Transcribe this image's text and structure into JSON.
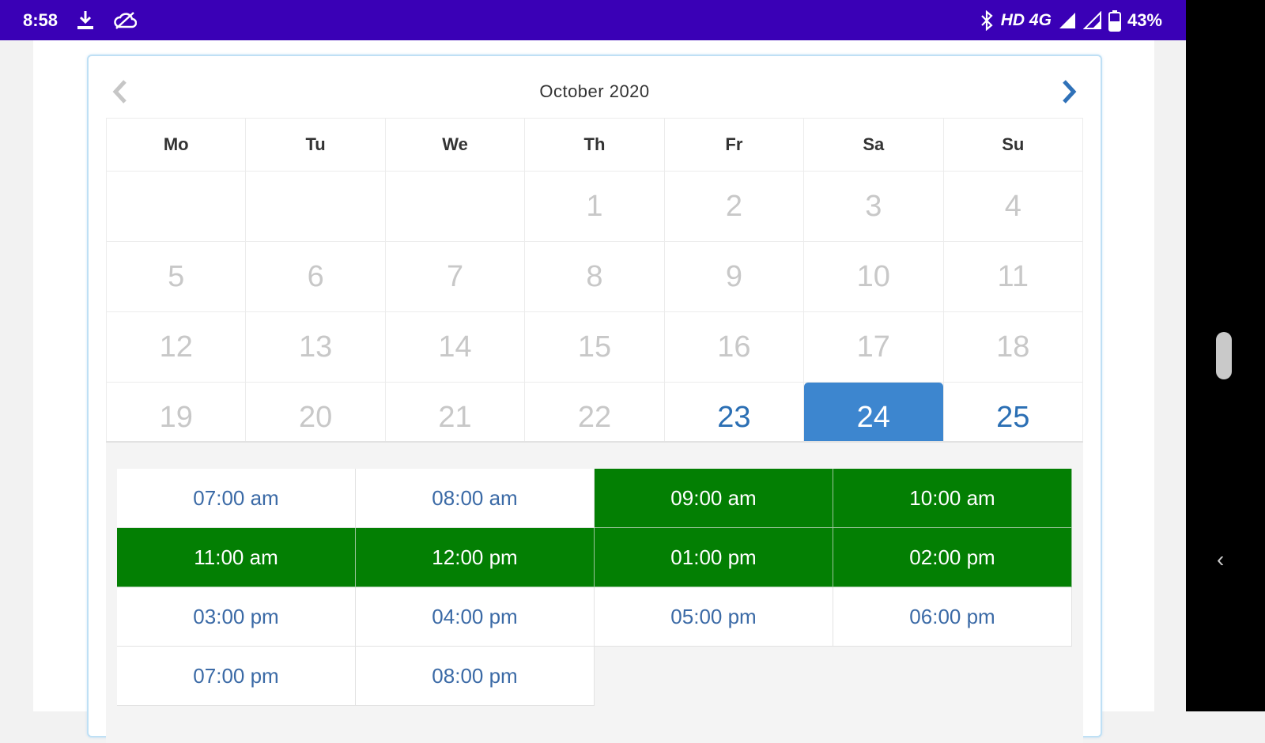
{
  "status_bar": {
    "time": "8:58",
    "network": "HD 4G",
    "battery": "43%",
    "icons": [
      "download-icon",
      "cloud-off-icon",
      "bluetooth-icon",
      "signal-icon",
      "signal-icon",
      "battery-icon"
    ]
  },
  "calendar": {
    "month_label": "October 2020",
    "prev_icon": "chevron-left-icon",
    "next_icon": "chevron-right-icon",
    "weekdays": [
      "Mo",
      "Tu",
      "We",
      "Th",
      "Fr",
      "Sa",
      "Su"
    ],
    "weeks": [
      [
        "",
        "",
        "",
        "1",
        "2",
        "3",
        "4"
      ],
      [
        "5",
        "6",
        "7",
        "8",
        "9",
        "10",
        "11"
      ],
      [
        "12",
        "13",
        "14",
        "15",
        "16",
        "17",
        "18"
      ],
      [
        "19",
        "20",
        "21",
        "22",
        "23",
        "24",
        "25"
      ]
    ],
    "available_days": [
      "23",
      "24",
      "25"
    ],
    "selected_day": "24"
  },
  "time_slots": [
    {
      "label": "07:00 am",
      "booked": false
    },
    {
      "label": "08:00 am",
      "booked": false
    },
    {
      "label": "09:00 am",
      "booked": true
    },
    {
      "label": "10:00 am",
      "booked": true
    },
    {
      "label": "11:00 am",
      "booked": true
    },
    {
      "label": "12:00 pm",
      "booked": true
    },
    {
      "label": "01:00 pm",
      "booked": true
    },
    {
      "label": "02:00 pm",
      "booked": true
    },
    {
      "label": "03:00 pm",
      "booked": false
    },
    {
      "label": "04:00 pm",
      "booked": false
    },
    {
      "label": "05:00 pm",
      "booked": false
    },
    {
      "label": "06:00 pm",
      "booked": false
    },
    {
      "label": "07:00 pm",
      "booked": false
    },
    {
      "label": "08:00 pm",
      "booked": false
    }
  ],
  "colors": {
    "status_bar": "#3a00b6",
    "available_day": "#2b6fb4",
    "selected_day": "#3d86cf",
    "booked_slot": "#037f03",
    "slot_text": "#3b6aa6"
  }
}
